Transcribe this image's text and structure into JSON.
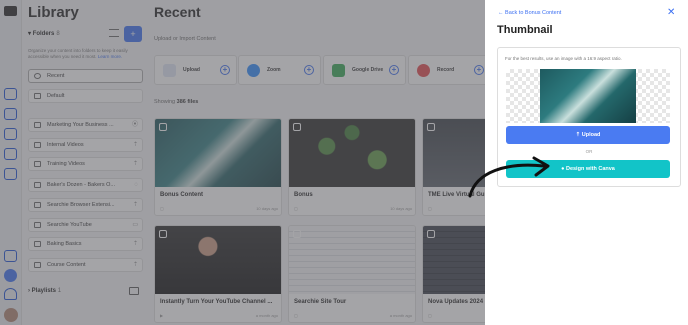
{
  "library": {
    "title": "Library",
    "folders_label": "Folders",
    "folders_count": "8",
    "help_text": "Organize your content into folders to keep it easily accessible when you need it most.",
    "learn_more": "Learn more.",
    "folders": [
      {
        "label": "Recent"
      },
      {
        "label": "Default"
      },
      {
        "label": "Marketing Your Business ..."
      },
      {
        "label": "Internal Videos"
      },
      {
        "label": "Training Videos"
      },
      {
        "label": "Baker's Dozen - Bakers O..."
      },
      {
        "label": "Searchie Browser Extensi..."
      },
      {
        "label": "Searchie YouTube"
      },
      {
        "label": "Baking Basics"
      },
      {
        "label": "Course Content"
      }
    ],
    "playlists_label": "Playlists",
    "playlists_count": "1"
  },
  "main": {
    "title": "Recent",
    "upload_label": "Upload or Import Content",
    "sources": [
      {
        "label": "Upload",
        "color": "#dfe7f7"
      },
      {
        "label": "Zoom",
        "color": "#2d8cff"
      },
      {
        "label": "Google Drive",
        "color": "#34a853"
      },
      {
        "label": "Record",
        "color": "#e5484d"
      }
    ],
    "showing_prefix": "Showing",
    "showing_count": "386 files",
    "videos": [
      {
        "title": "Bonus Content",
        "ago": "10 days ago"
      },
      {
        "title": "Bonus",
        "ago": "10 days ago"
      },
      {
        "title": "TME Live Virtual Gu",
        "ago": ""
      },
      {
        "title": "Instantly Turn Your YouTube Channel ...",
        "ago": "a month ago"
      },
      {
        "title": "Searchie Site Tour",
        "ago": "a month ago"
      },
      {
        "title": "Nova Updates 2024",
        "ago": ""
      }
    ]
  },
  "drawer": {
    "back_link": "Back to Bonus Content",
    "close": "✕",
    "title": "Thumbnail",
    "description": "For the best results, use an image with a 16:9 aspect ratio.",
    "upload_button": "Upload",
    "or_text": "OR",
    "canva_button": "Design with Canva"
  },
  "colors": {
    "accent": "#3b6ff2",
    "canva": "#12c4c8"
  }
}
